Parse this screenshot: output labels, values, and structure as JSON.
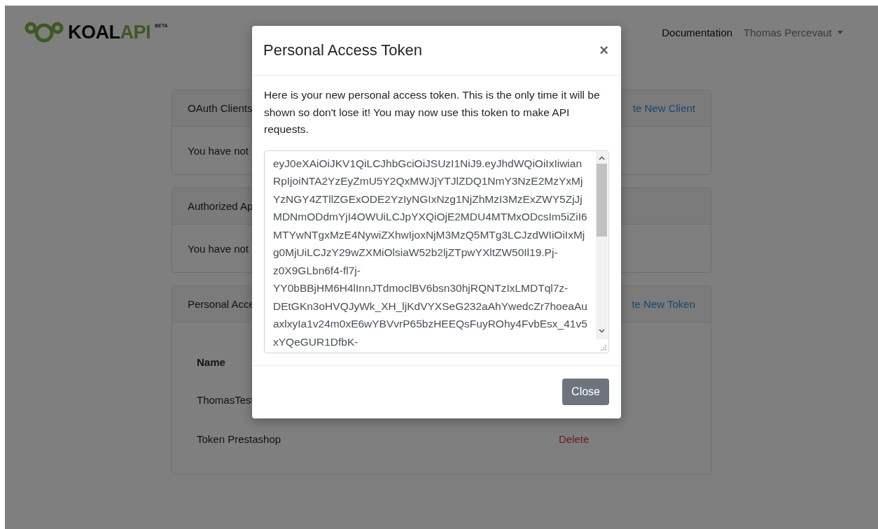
{
  "navbar": {
    "logo": {
      "name_dark": "KOAL",
      "name_accent": "API",
      "badge": "BETA"
    },
    "links": [
      {
        "label": "Documentation",
        "kind": "link"
      },
      {
        "label": "Thomas Percevaut",
        "kind": "dropdown"
      }
    ]
  },
  "cards": [
    {
      "title": "OAuth Clients",
      "action": "te New Client",
      "body": "You have not"
    },
    {
      "title": "Authorized Ap",
      "body": "You have not"
    },
    {
      "title": "Personal Acce",
      "action": "te New Token",
      "table": {
        "header": "Name",
        "rows": [
          {
            "name": "ThomasTest"
          },
          {
            "name": "Token Prestashop",
            "action": "Delete"
          }
        ]
      }
    }
  ],
  "modal": {
    "title": "Personal Access Token",
    "close_icon": "×",
    "message": "Here is your new personal access token. This is the only time it will be shown so don't lose it! You may now use this token to make API requests.",
    "token": "eyJ0eXAiOiJKV1QiLCJhbGciOiJSUzI1NiJ9.eyJhdWQiOiIxIiwianRpIjoiNTA2YzEyZmU5Y2QxMWJjYTJlZDQ1NmY3NzE2MzYxMjYzNGY4ZTllZGExODE2YzIyNGIxNzg1NjZhMzI3MzExZWY5ZjJjMDNmODdmYjI4OWUiLCJpYXQiOjE2MDU4MTMxODcsIm5iZiI6MTYwNTgxMzE4NywiZXhwIjoxNjM3MzQ5MTg3LCJzdWIiOiIxMjg0MjUiLCJzY29wZXMiOlsiaW52b2ljZTpwYXltZW50Il19.Pj-z0X9GLbn6f4-fl7j-YY0bBBjHM6H4lInnJTdmoclBV6bsn30hjRQNTzIxLMDTql7z-DEtGKn3oHVQJyWk_XH_ljKdVYXSeG232aAhYwedcZr7hoeaAuaxlxyIa1v24m0xE6wYBVvrP65bzHEEQsFuyROhy4FvbEsx_41v5xYQeGUR1DfbK-",
    "buttons": [
      "Close"
    ]
  }
}
